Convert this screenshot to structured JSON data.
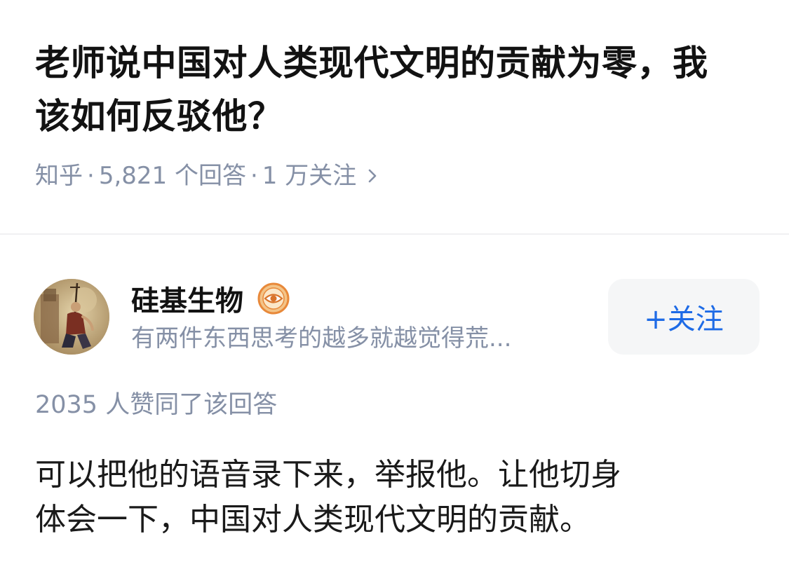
{
  "question": {
    "title": "老师说中国对人类现代文明的贡献为零，我该如何反驳他？",
    "meta": {
      "source": "知乎",
      "answers": "5,821 个回答",
      "followers": "1 万关注",
      "separator": "·",
      "chevron_icon": "chevron-right-icon"
    }
  },
  "answer": {
    "author": {
      "name": "硅基生物",
      "bio": "有两件东西思考的越多就越觉得荒...",
      "badge_icon": "eye-badge-icon",
      "avatar": "avatar-illustration"
    },
    "follow_button": "+关注",
    "upvote_text": "2035 人赞同了该回答",
    "content_lines": [
      "可以把他的语音录下来，举报他。让他切身",
      "体会一下，中国对人类现代文明的贡献。"
    ]
  },
  "colors": {
    "meta_gray": "#8590a6",
    "accent_blue": "#1e6be6",
    "button_bg": "#f5f6f7",
    "badge_orange": "#e8893a"
  }
}
